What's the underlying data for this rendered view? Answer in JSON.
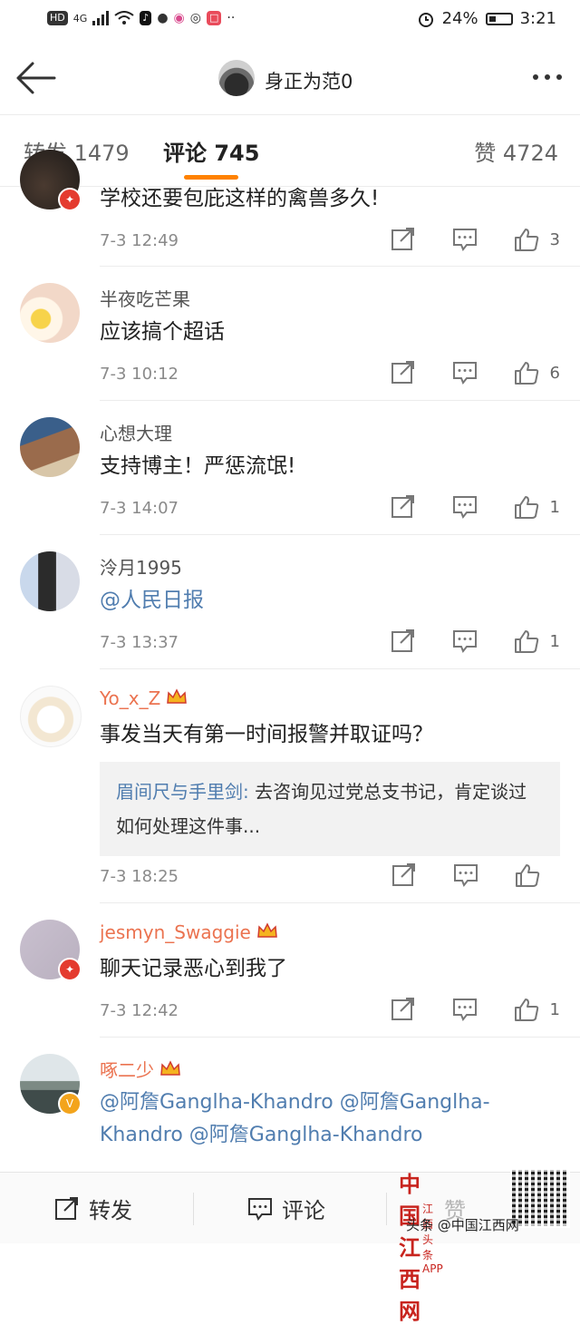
{
  "status": {
    "left_items": [
      "HD",
      "4G"
    ],
    "battery": "24%",
    "time": "3:21"
  },
  "header": {
    "title": "身正为范0"
  },
  "tabs": {
    "repost": "转发 1479",
    "comments": "评论 745",
    "likes": "赞 4724"
  },
  "comments": [
    {
      "name": "",
      "text": "学校还要包庇这样的禽兽多久!",
      "time": "7-3 12:49",
      "likes": "3"
    },
    {
      "name": "半夜吃芒果",
      "text": "应该搞个超话",
      "time": "7-3 10:12",
      "likes": "6"
    },
    {
      "name": "心想大理",
      "text": "支持博主！严惩流氓!",
      "time": "7-3 14:07",
      "likes": "1"
    },
    {
      "name": "泠月1995",
      "text": "@人民日报",
      "time": "7-3 13:37",
      "likes": "1"
    },
    {
      "name": "Yo_x_Z",
      "text": "事发当天有第一时间报警并取证吗？",
      "time": "7-3 18:25",
      "likes": "",
      "reply_author": "眉间尺与手里剑:",
      "reply_text": "去咨询见过党总支书记，肯定谈过如何处理这件事..."
    },
    {
      "name": "jesmyn_Swaggie",
      "text": "聊天记录恶心到我了",
      "time": "7-3 12:42",
      "likes": "1"
    },
    {
      "name": "啄二少",
      "text": "@阿詹Ganglha-Khandro @阿詹Ganglha-Khandro @阿詹Ganglha-Khandro"
    }
  ],
  "bottom": {
    "repost": "转发",
    "comment": "评论",
    "like": "赞"
  },
  "watermark": {
    "logo": "中国江西网",
    "sub": "江西头条APP",
    "caption": "头条 @中国江西网"
  }
}
